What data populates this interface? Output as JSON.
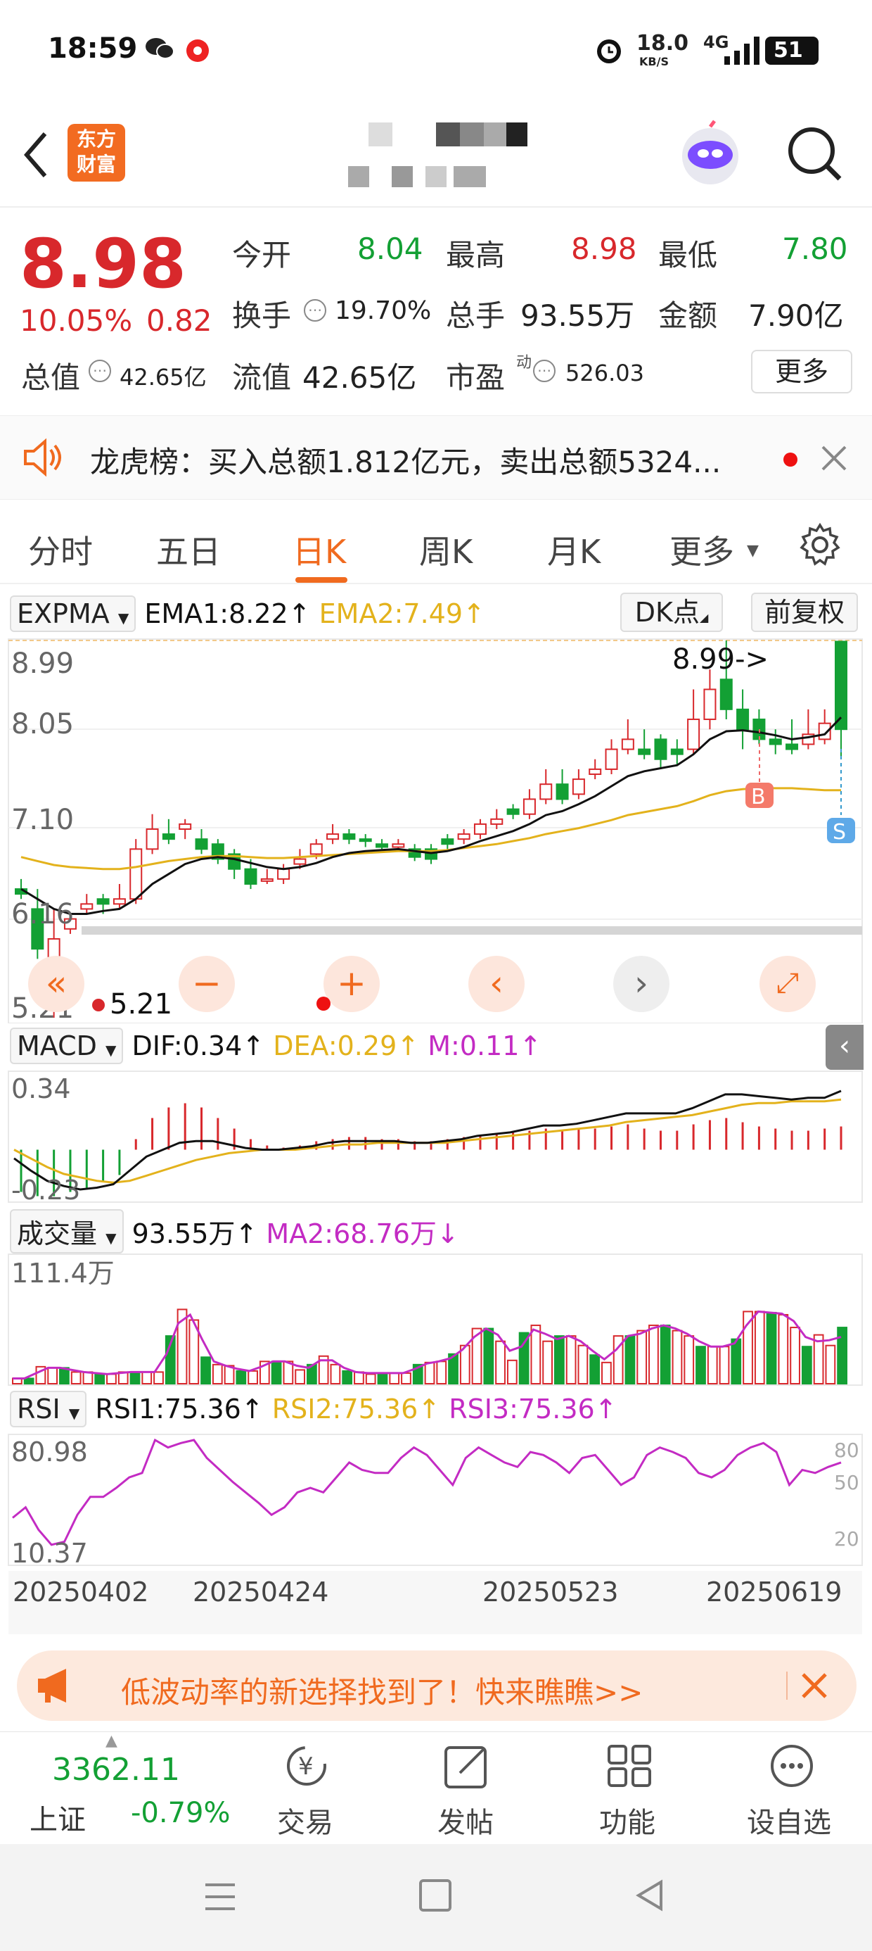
{
  "status_bar": {
    "time": "18:59",
    "speed": "18.0",
    "speed_unit": "KB/S",
    "network": "4G",
    "battery": "51"
  },
  "header": {
    "logo_line1": "东方",
    "logo_line2": "财富"
  },
  "quote": {
    "price": "8.98",
    "change_pct": "10.05%",
    "change_abs": "0.82",
    "open_label": "今开",
    "open": "8.04",
    "high_label": "最高",
    "high": "8.98",
    "low_label": "最低",
    "low": "7.80",
    "turnover_label": "换手",
    "turnover": "19.70%",
    "volume_label": "总手",
    "volume": "93.55万",
    "amount_label": "金额",
    "amount": "7.90亿",
    "mktcap_label": "总值",
    "mktcap": "42.65亿",
    "float_label": "流值",
    "float": "42.65亿",
    "pe_label": "市盈",
    "pe_sup": "动",
    "pe": "526.03",
    "more_button": "更多"
  },
  "notice": {
    "text": "龙虎榜：买入总额1.812亿元，卖出总额5324..."
  },
  "tabs": [
    "分时",
    "五日",
    "日K",
    "周K",
    "月K",
    "更多"
  ],
  "active_tab": "日K",
  "main_indicator": {
    "name": "EXPMA",
    "ema1": "EMA1:8.22↑",
    "ema2": "EMA2:7.49↑",
    "dk_button": "DK点",
    "adjust_button": "前复权",
    "y_labels": [
      "8.99",
      "8.05",
      "7.10",
      "6.16",
      "5.21"
    ],
    "high_marker": "8.99->",
    "low_marker": "5.21",
    "buy_marker": "B",
    "sell_marker": "S"
  },
  "macd": {
    "name": "MACD",
    "dif": "DIF:0.34↑",
    "dea": "DEA:0.29↑",
    "m": "M:0.11↑",
    "y_top": "0.34",
    "y_bottom": "-0.23"
  },
  "volume_panel": {
    "name": "成交量",
    "value": "93.55万↑",
    "ma2": "MA2:68.76万↓",
    "y_top": "111.4万"
  },
  "rsi": {
    "name": "RSI",
    "rsi1": "RSI1:75.36↑",
    "rsi2": "RSI2:75.36↑",
    "rsi3": "RSI3:75.36↑",
    "y_top": "80.98",
    "y_bottom": "10.37",
    "right_labels": [
      "80",
      "50",
      "20"
    ]
  },
  "dates": [
    "20250402",
    "20250424",
    "20250523",
    "20250619"
  ],
  "ad_banner": {
    "text": "低波动率的新选择找到了！快来瞧瞧>>"
  },
  "footer": {
    "index_value": "3362.11",
    "index_name": "上证",
    "index_change": "-0.79%",
    "items": [
      "交易",
      "发帖",
      "功能",
      "设自选"
    ]
  },
  "colors": {
    "up": "#d8282c",
    "down": "#13a034",
    "accent": "#f06a1f",
    "ema2": "#e3b21c",
    "magenta": "#c32bc3"
  },
  "chart_data": {
    "type": "candlestick",
    "series": [
      {
        "name": "open",
        "values": [
          6.5,
          6.3,
          5.4,
          6.1,
          6.3,
          6.4,
          6.35,
          6.4,
          6.9,
          7.05,
          7.1,
          7.0,
          6.95,
          6.85,
          6.7,
          6.6,
          6.6,
          6.75,
          6.85,
          7.0,
          7.05,
          7.0,
          6.95,
          6.92,
          6.9,
          6.9,
          7.0,
          7.0,
          7.05,
          7.15,
          7.3,
          7.25,
          7.4,
          7.55,
          7.45,
          7.65,
          7.7,
          7.9,
          7.9,
          8.0,
          7.9,
          7.9,
          8.2,
          8.6,
          8.3,
          8.2,
          8.0,
          7.95,
          7.95,
          8.0,
          8.98
        ]
      },
      {
        "name": "close",
        "values": [
          6.45,
          5.9,
          6.0,
          6.2,
          6.35,
          6.35,
          6.4,
          6.9,
          7.1,
          7.0,
          7.15,
          6.9,
          6.8,
          6.7,
          6.55,
          6.6,
          6.7,
          6.8,
          6.95,
          7.05,
          7.0,
          6.98,
          6.92,
          6.95,
          6.82,
          6.8,
          6.95,
          7.05,
          7.15,
          7.2,
          7.25,
          7.4,
          7.55,
          7.4,
          7.6,
          7.7,
          7.9,
          8.0,
          7.85,
          7.8,
          7.85,
          8.2,
          8.5,
          8.3,
          8.1,
          8.0,
          7.95,
          7.9,
          8.05,
          8.16,
          8.1
        ]
      },
      {
        "name": "high",
        "values": [
          6.6,
          6.5,
          6.3,
          6.25,
          6.45,
          6.45,
          6.55,
          7.0,
          7.25,
          7.2,
          7.2,
          7.1,
          7.0,
          6.9,
          6.8,
          6.7,
          6.75,
          6.9,
          7.0,
          7.15,
          7.1,
          7.05,
          7.0,
          7.0,
          6.95,
          6.95,
          7.05,
          7.1,
          7.2,
          7.3,
          7.35,
          7.5,
          7.7,
          7.7,
          7.7,
          7.8,
          8.0,
          8.2,
          8.1,
          8.05,
          8.0,
          8.5,
          8.7,
          8.99,
          8.5,
          8.3,
          8.1,
          8.2,
          8.3,
          8.3,
          8.98
        ]
      },
      {
        "name": "low",
        "values": [
          6.4,
          5.8,
          5.21,
          6.05,
          6.25,
          6.25,
          6.3,
          6.35,
          6.85,
          6.95,
          7.0,
          6.85,
          6.75,
          6.6,
          6.5,
          6.55,
          6.55,
          6.7,
          6.8,
          6.95,
          6.95,
          6.92,
          6.9,
          6.88,
          6.78,
          6.75,
          6.9,
          6.95,
          7.0,
          7.1,
          7.2,
          7.2,
          7.35,
          7.35,
          7.4,
          7.6,
          7.65,
          7.85,
          7.8,
          7.7,
          7.75,
          7.85,
          8.1,
          8.2,
          7.9,
          7.95,
          7.85,
          7.85,
          7.9,
          7.95,
          7.8
        ]
      },
      {
        "name": "EMA1",
        "values": [
          6.5,
          6.4,
          6.3,
          6.25,
          6.25,
          6.28,
          6.3,
          6.4,
          6.55,
          6.65,
          6.75,
          6.8,
          6.82,
          6.8,
          6.76,
          6.72,
          6.7,
          6.72,
          6.76,
          6.82,
          6.86,
          6.88,
          6.89,
          6.9,
          6.88,
          6.86,
          6.88,
          6.92,
          6.98,
          7.03,
          7.08,
          7.15,
          7.24,
          7.28,
          7.35,
          7.43,
          7.53,
          7.63,
          7.68,
          7.71,
          7.74,
          7.85,
          8.0,
          8.08,
          8.09,
          8.07,
          8.04,
          8.0,
          8.02,
          8.05,
          8.22
        ]
      },
      {
        "name": "EMA2",
        "values": [
          6.82,
          6.78,
          6.74,
          6.72,
          6.71,
          6.7,
          6.7,
          6.72,
          6.75,
          6.78,
          6.8,
          6.82,
          6.83,
          6.83,
          6.82,
          6.81,
          6.81,
          6.82,
          6.83,
          6.84,
          6.85,
          6.86,
          6.87,
          6.88,
          6.88,
          6.88,
          6.89,
          6.91,
          6.93,
          6.95,
          6.98,
          7.01,
          7.05,
          7.08,
          7.11,
          7.15,
          7.19,
          7.24,
          7.27,
          7.3,
          7.33,
          7.38,
          7.44,
          7.48,
          7.5,
          7.51,
          7.51,
          7.51,
          7.5,
          7.49,
          7.49
        ]
      },
      {
        "name": "MACD_hist",
        "values": [
          -0.2,
          -0.22,
          -0.22,
          -0.2,
          -0.18,
          -0.15,
          -0.12,
          0.05,
          0.15,
          0.2,
          0.22,
          0.2,
          0.15,
          0.1,
          0.05,
          0.02,
          0.01,
          0.02,
          0.04,
          0.05,
          0.06,
          0.06,
          0.05,
          0.05,
          0.04,
          0.04,
          0.05,
          0.06,
          0.07,
          0.08,
          0.08,
          0.09,
          0.1,
          0.09,
          0.1,
          0.1,
          0.11,
          0.12,
          0.1,
          0.09,
          0.09,
          0.12,
          0.14,
          0.15,
          0.13,
          0.11,
          0.1,
          0.09,
          0.09,
          0.1,
          0.11
        ]
      },
      {
        "name": "DIF",
        "values": [
          -0.05,
          -0.12,
          -0.18,
          -0.21,
          -0.23,
          -0.22,
          -0.2,
          -0.12,
          -0.04,
          0.0,
          0.04,
          0.05,
          0.05,
          0.03,
          0.01,
          0.0,
          0.0,
          0.01,
          0.02,
          0.04,
          0.05,
          0.05,
          0.05,
          0.05,
          0.04,
          0.04,
          0.05,
          0.06,
          0.08,
          0.09,
          0.1,
          0.12,
          0.14,
          0.14,
          0.15,
          0.17,
          0.19,
          0.21,
          0.21,
          0.21,
          0.21,
          0.24,
          0.28,
          0.32,
          0.32,
          0.31,
          0.3,
          0.29,
          0.3,
          0.3,
          0.34
        ]
      },
      {
        "name": "DEA",
        "values": [
          0.0,
          -0.05,
          -0.1,
          -0.14,
          -0.16,
          -0.18,
          -0.19,
          -0.18,
          -0.15,
          -0.12,
          -0.09,
          -0.06,
          -0.04,
          -0.02,
          -0.01,
          0.0,
          0.0,
          0.0,
          0.01,
          0.02,
          0.03,
          0.03,
          0.04,
          0.04,
          0.04,
          0.04,
          0.04,
          0.05,
          0.06,
          0.07,
          0.08,
          0.09,
          0.1,
          0.11,
          0.12,
          0.13,
          0.14,
          0.16,
          0.17,
          0.18,
          0.19,
          0.2,
          0.22,
          0.24,
          0.26,
          0.27,
          0.27,
          0.28,
          0.28,
          0.28,
          0.29
        ]
      },
      {
        "name": "VOL",
        "values": [
          5,
          5,
          16,
          15,
          15,
          11,
          11,
          9,
          9,
          11,
          11,
          11,
          11,
          45,
          70,
          60,
          25,
          18,
          17,
          12,
          12,
          21,
          21,
          21,
          13,
          18,
          26,
          18,
          12,
          11,
          9,
          10,
          10,
          10,
          18,
          20,
          21,
          28,
          36,
          52,
          52,
          40,
          22,
          48,
          55,
          40,
          45,
          45,
          36,
          27,
          20,
          45,
          45,
          50,
          55,
          55,
          50,
          45,
          35,
          35,
          35,
          42,
          68,
          68,
          67,
          65,
          53,
          35,
          46,
          36,
          53
        ]
      },
      {
        "name": "VOL_MA2",
        "values": [
          5,
          5,
          10,
          15,
          15,
          13,
          11,
          10,
          9,
          10,
          11,
          11,
          11,
          28,
          57,
          65,
          42,
          21,
          17,
          14,
          12,
          16,
          21,
          21,
          17,
          15,
          22,
          22,
          15,
          11,
          10,
          10,
          10,
          10,
          14,
          19,
          21,
          24,
          32,
          44,
          52,
          46,
          31,
          35,
          51,
          47,
          42,
          45,
          40,
          31,
          23,
          32,
          45,
          47,
          52,
          55,
          52,
          47,
          40,
          35,
          35,
          38,
          55,
          68,
          67,
          66,
          59,
          44,
          40,
          41,
          44
        ]
      },
      {
        "name": "RSI",
        "values": [
          38,
          45,
          30,
          20,
          22,
          40,
          52,
          52,
          58,
          65,
          68,
          90,
          85,
          88,
          90,
          78,
          70,
          62,
          55,
          48,
          40,
          45,
          55,
          58,
          55,
          65,
          75,
          70,
          68,
          68,
          78,
          85,
          80,
          70,
          60,
          78,
          85,
          80,
          75,
          72,
          82,
          80,
          75,
          68,
          78,
          80,
          70,
          60,
          65,
          80,
          85,
          82,
          78,
          68,
          65,
          70,
          80,
          85,
          88,
          82,
          60,
          70,
          68,
          72,
          75
        ]
      }
    ]
  }
}
